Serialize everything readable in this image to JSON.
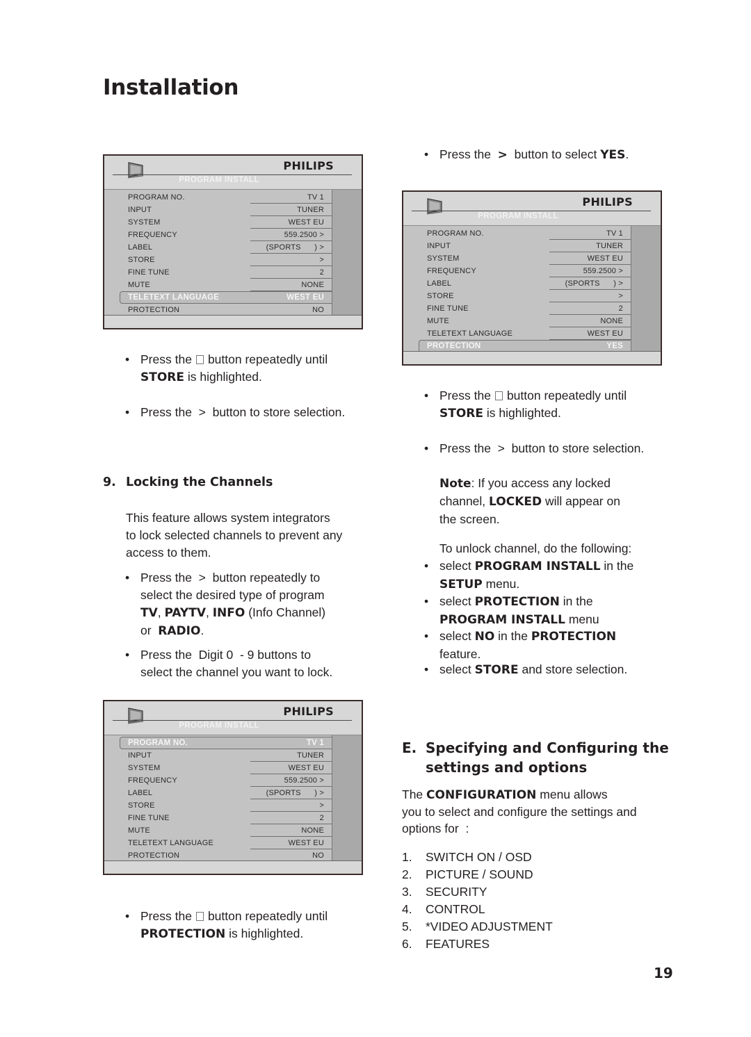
{
  "page": {
    "title": "Installation",
    "page_number": "19"
  },
  "menus": [
    {
      "brand": "PHILIPS",
      "title": "PROGRAM INSTALL",
      "icon": "tv-icon",
      "highlighted_index": 8,
      "rows": [
        {
          "label": "PROGRAM NO.",
          "value": "TV 1"
        },
        {
          "label": "INPUT",
          "value": "TUNER"
        },
        {
          "label": "SYSTEM",
          "value": "WEST EU"
        },
        {
          "label": "FREQUENCY",
          "value": "559.2500 >"
        },
        {
          "label": "LABEL",
          "value": "(SPORTS      ) >"
        },
        {
          "label": "STORE",
          "value": ">"
        },
        {
          "label": "FINE TUNE",
          "value": "2"
        },
        {
          "label": "MUTE",
          "value": "NONE"
        },
        {
          "label": "TELETEXT LANGUAGE",
          "value": "WEST EU"
        },
        {
          "label": "PROTECTION",
          "value": "NO"
        }
      ]
    },
    {
      "brand": "PHILIPS",
      "title": "PROGRAM INSTALL",
      "icon": "tv-icon",
      "highlighted_index": 9,
      "rows": [
        {
          "label": "PROGRAM NO.",
          "value": "TV 1"
        },
        {
          "label": "INPUT",
          "value": "TUNER"
        },
        {
          "label": "SYSTEM",
          "value": "WEST EU"
        },
        {
          "label": "FREQUENCY",
          "value": "559.2500 >"
        },
        {
          "label": "LABEL",
          "value": "(SPORTS      ) >"
        },
        {
          "label": "STORE",
          "value": ">"
        },
        {
          "label": "FINE TUNE",
          "value": "2"
        },
        {
          "label": "MUTE",
          "value": "NONE"
        },
        {
          "label": "TELETEXT LANGUAGE",
          "value": "WEST EU"
        },
        {
          "label": "PROTECTION",
          "value": "YES"
        }
      ]
    },
    {
      "brand": "PHILIPS",
      "title": "PROGRAM INSTALL",
      "icon": "tv-icon",
      "highlighted_index": 0,
      "rows": [
        {
          "label": "PROGRAM NO.",
          "value": "TV 1"
        },
        {
          "label": "INPUT",
          "value": "TUNER"
        },
        {
          "label": "SYSTEM",
          "value": "WEST EU"
        },
        {
          "label": "FREQUENCY",
          "value": "559.2500 >"
        },
        {
          "label": "LABEL",
          "value": "(SPORTS      ) >"
        },
        {
          "label": "STORE",
          "value": ">"
        },
        {
          "label": "FINE TUNE",
          "value": "2"
        },
        {
          "label": "MUTE",
          "value": "NONE"
        },
        {
          "label": "TELETEXT LANGUAGE",
          "value": "WEST EU"
        },
        {
          "label": "PROTECTION",
          "value": "NO"
        }
      ]
    }
  ],
  "left": {
    "store_bullet": {
      "pre": "Press the",
      "post": "button repeatedly until",
      "bold": "STORE",
      "tail": "is highlighted."
    },
    "store_select_bullet": "Press the  >  button to store selection.",
    "section9": {
      "number": "9.",
      "heading": "Locking the Channels",
      "para": [
        "This feature allows system integrators",
        "to lock selected channels to prevent any",
        "access to them."
      ],
      "bullet1": {
        "l1": "Press the  >  button repeatedly to",
        "l2": "select the desired type of program",
        "b_tv": "TV",
        "b_paytv": "PAYTV",
        "b_info": "INFO",
        "info_note": "(Info Channel)",
        "or": "or",
        "b_radio": "RADIO"
      },
      "bullet2": [
        "Press the  Digit 0  - 9 buttons to",
        "select the channel you want to lock."
      ]
    },
    "protection_bullet": {
      "pre": "Press the",
      "post": "button repeatedly until",
      "bold": "PROTECTION",
      "tail": "is highlighted."
    }
  },
  "right": {
    "yes_bullet": {
      "pre": "Press the",
      "arrow": ">",
      "mid": "button to select",
      "bold": "YES"
    },
    "store_bullet": {
      "pre": "Press the",
      "post": "button repeatedly until",
      "bold": "STORE",
      "tail": "is highlighted."
    },
    "store_select_bullet": "Press the  >  button to store selection.",
    "note": {
      "bold": "Note",
      "l1": ": If you access any locked",
      "l2a": "channel,",
      "l2b": "LOCKED",
      "l2c": "will appear on",
      "l3": "the screen."
    },
    "unlock_intro": "To unlock channel, do the following:",
    "unlock_steps": {
      "s1": {
        "a": "select",
        "b": "PROGRAM INSTALL",
        "c": "in the",
        "d": "SETUP",
        "e": "menu."
      },
      "s2": {
        "a": "select",
        "b": "PROTECTION",
        "c": "in the",
        "d": "PROGRAM INSTALL",
        "e": "menu"
      },
      "s3": {
        "a": "select",
        "b": "NO",
        "c": "in the",
        "d": "PROTECTION",
        "e": "feature."
      },
      "s4": {
        "a": "select",
        "b": "STORE",
        "c": "and store selection."
      }
    },
    "sectionE": {
      "letter": "E.",
      "heading_l1": "Specifying and Configuring the",
      "heading_l2": "settings and options",
      "intro_a": "The",
      "intro_b": "CONFIGURATION",
      "intro_c": "menu allows",
      "intro_l2": "you to select and configure the settings and",
      "intro_l3": "options for  :",
      "options": [
        {
          "num": "1.",
          "label": "SWITCH ON / OSD"
        },
        {
          "num": "2.",
          "label": "PICTURE / SOUND"
        },
        {
          "num": "3.",
          "label": "SECURITY"
        },
        {
          "num": "4.",
          "label": "CONTROL"
        },
        {
          "num": "5.",
          "label": "*VIDEO ADJUSTMENT"
        },
        {
          "num": "6.",
          "label": "FEATURES"
        }
      ]
    }
  }
}
